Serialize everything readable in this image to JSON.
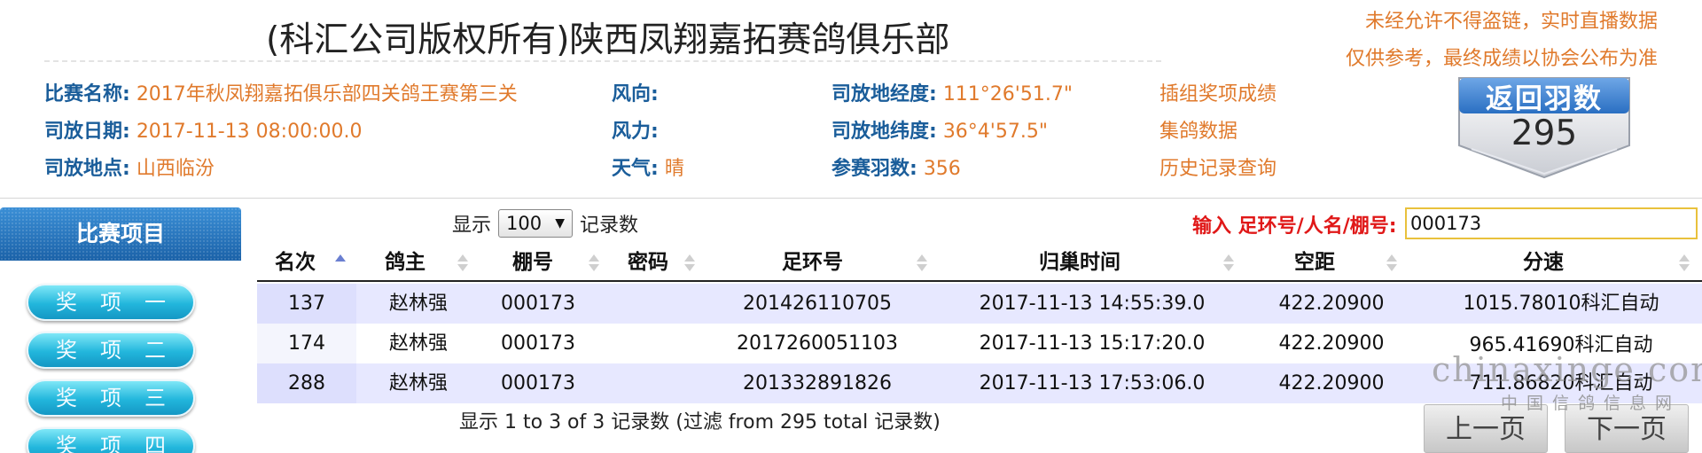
{
  "header": {
    "title": "(科汇公司版权所有)陕西凤翔嘉拓赛鸽俱乐部",
    "notice_line1": "未经允许不得盗链，实时直播数据",
    "notice_line2": "仅供参考，最终成绩以协会公布为准"
  },
  "race_info": {
    "name_label": "比赛名称:",
    "name_value": "2017年秋凤翔嘉拓俱乐部四关鸽王赛第三关",
    "date_label": "司放日期:",
    "date_value": "2017-11-13 08:00:00.0",
    "place_label": "司放地点:",
    "place_value": "山西临汾",
    "wind_dir_label": "风向:",
    "wind_dir_value": "",
    "wind_force_label": "风力:",
    "wind_force_value": "",
    "weather_label": "天气:",
    "weather_value": "晴",
    "longitude_label": "司放地经度:",
    "longitude_value": "111°26'51.7\"",
    "latitude_label": "司放地纬度:",
    "latitude_value": "36°4'57.5\"",
    "participants_label": "参赛羽数:",
    "participants_value": "356"
  },
  "links": {
    "group_awards": "插组奖项成绩",
    "collection_data": "集鸽数据",
    "history_query": "历史记录查询"
  },
  "return_badge": {
    "title": "返回羽数",
    "count": "295"
  },
  "sidebar": {
    "title": "比赛项目",
    "items": [
      {
        "label": "奖项一"
      },
      {
        "label": "奖项二"
      },
      {
        "label": "奖项三"
      },
      {
        "label": "奖项四"
      }
    ]
  },
  "table_controls": {
    "show_label": "显示",
    "page_size": "100",
    "records_label": "记录数",
    "search_label": "输入 足环号/人名/棚号:",
    "search_value": "000173"
  },
  "table": {
    "columns": [
      "名次",
      "鸽主",
      "棚号",
      "密码",
      "足环号",
      "归巢时间",
      "空距",
      "分速"
    ],
    "rows": [
      [
        "137",
        "赵林强",
        "000173",
        "",
        "201426110705",
        "2017-11-13 14:55:39.0",
        "422.20900",
        "1015.78010科汇自动"
      ],
      [
        "174",
        "赵林强",
        "000173",
        "",
        "2017260051103",
        "2017-11-13 15:17:20.0",
        "422.20900",
        "965.41690科汇自动"
      ],
      [
        "288",
        "赵林强",
        "000173",
        "",
        "201332891826",
        "2017-11-13 17:53:06.0",
        "422.20900",
        "711.86820科汇自动"
      ]
    ],
    "info": "显示 1 to 3 of 3 记录数 (过滤 from 295 total 记录数)"
  },
  "pagination": {
    "prev": "上一页",
    "next": "下一页"
  },
  "watermark": {
    "en": "chinaxinge.com",
    "cn": "中国信鸽信息网"
  }
}
